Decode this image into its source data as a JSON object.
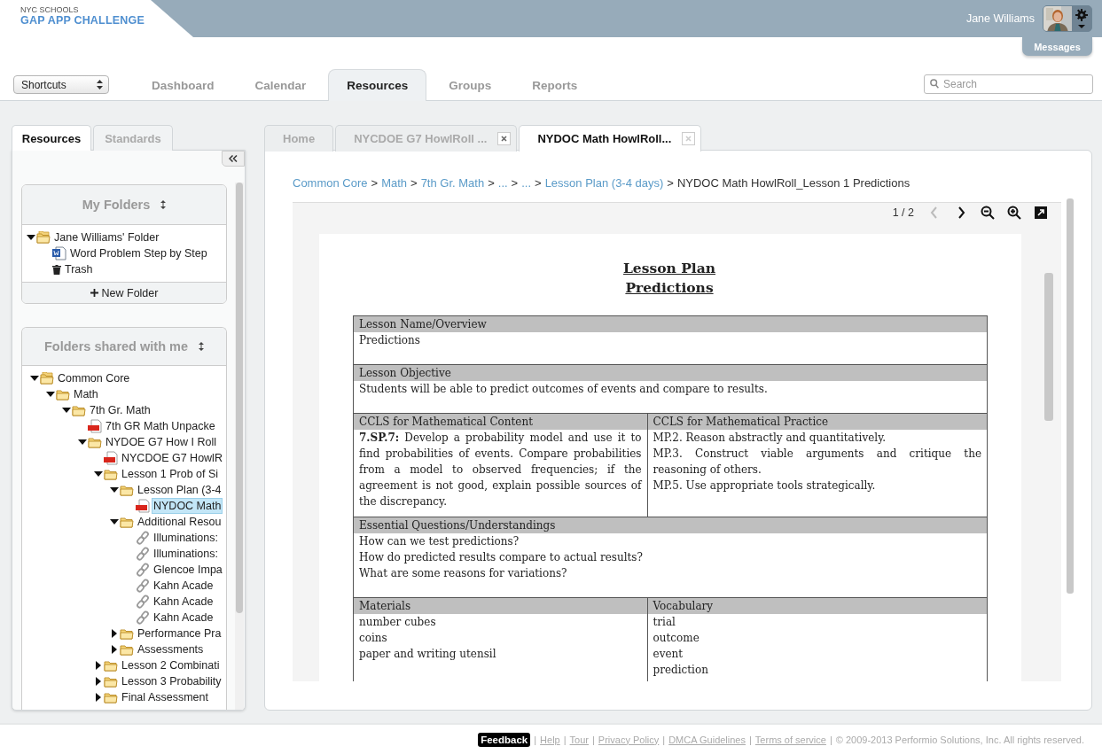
{
  "header": {
    "logo_small": "NYC SCHOOLS",
    "logo_main": "GAP APP CHALLENGE",
    "user_name": "Jane Williams",
    "messages": "Messages"
  },
  "nav": {
    "shortcuts": "Shortcuts",
    "tabs": [
      {
        "label": "Dashboard",
        "selected": false
      },
      {
        "label": "Calendar",
        "selected": false
      },
      {
        "label": "Resources",
        "selected": true
      },
      {
        "label": "Groups",
        "selected": false
      },
      {
        "label": "Reports",
        "selected": false
      }
    ],
    "search": {
      "placeholder": "Search"
    }
  },
  "sidebar": {
    "tabs": [
      {
        "label": "Resources",
        "selected": true
      },
      {
        "label": "Standards",
        "selected": false
      }
    ],
    "my_folders": {
      "title": "My Folders",
      "tree": [
        {
          "kind": "shared",
          "label": "Jane Williams' Folder",
          "expanded": true,
          "selected": false,
          "children": [
            {
              "kind": "word",
              "label": "Word Problem Step by Step",
              "selected": false
            },
            {
              "kind": "trash",
              "label": "Trash",
              "selected": false
            }
          ]
        }
      ],
      "new_folder": "New Folder"
    },
    "shared_folders": {
      "title": "Folders shared with me",
      "tree": [
        {
          "kind": "shared",
          "label": "Common Core",
          "expanded": true,
          "selected": false,
          "children": [
            {
              "kind": "folder",
              "label": "Math",
              "expanded": true,
              "selected": false,
              "children": [
                {
                  "kind": "folder",
                  "label": "7th Gr. Math",
                  "expanded": true,
                  "selected": false,
                  "children": [
                    {
                      "kind": "pdf",
                      "label": "7th GR Math Unpacke",
                      "selected": false
                    },
                    {
                      "kind": "folder",
                      "label": "NYDOE G7 How I Roll",
                      "expanded": true,
                      "selected": false,
                      "children": [
                        {
                          "kind": "pdf",
                          "label": "NYCDOE G7 HowlR",
                          "selected": false
                        },
                        {
                          "kind": "folder",
                          "label": "Lesson 1 Prob of Si",
                          "expanded": true,
                          "selected": false,
                          "children": [
                            {
                              "kind": "folder",
                              "label": "Lesson Plan (3-4",
                              "expanded": true,
                              "selected": false,
                              "children": [
                                {
                                  "kind": "pdf",
                                  "label": "NYDOC Math",
                                  "selected": true
                                }
                              ]
                            },
                            {
                              "kind": "folder",
                              "label": "Additional Resou",
                              "expanded": true,
                              "selected": false,
                              "children": [
                                {
                                  "kind": "link",
                                  "label": "Illuminations:",
                                  "selected": false
                                },
                                {
                                  "kind": "link",
                                  "label": "Illuminations:",
                                  "selected": false
                                },
                                {
                                  "kind": "link",
                                  "label": "Glencoe Impa",
                                  "selected": false
                                },
                                {
                                  "kind": "link",
                                  "label": "Kahn Acade",
                                  "selected": false
                                },
                                {
                                  "kind": "link",
                                  "label": "Kahn Acade",
                                  "selected": false
                                },
                                {
                                  "kind": "link",
                                  "label": "Kahn Acade",
                                  "selected": false
                                }
                              ]
                            },
                            {
                              "kind": "folder",
                              "label": "Performance Pra",
                              "expanded": false,
                              "selected": false
                            },
                            {
                              "kind": "folder",
                              "label": "Assessments",
                              "expanded": false,
                              "selected": false
                            }
                          ]
                        },
                        {
                          "kind": "folder",
                          "label": "Lesson 2 Combinati",
                          "expanded": false,
                          "selected": false
                        },
                        {
                          "kind": "folder",
                          "label": "Lesson 3 Probability",
                          "expanded": false,
                          "selected": false
                        },
                        {
                          "kind": "folder",
                          "label": "Final Assessment",
                          "expanded": false,
                          "selected": false
                        }
                      ]
                    }
                  ]
                }
              ]
            }
          ]
        }
      ]
    }
  },
  "content": {
    "tabs": [
      {
        "label": "Home",
        "selected": false,
        "closable": false
      },
      {
        "label": "NYCDOE G7 HowlRoll ...",
        "selected": false,
        "closable": true
      },
      {
        "label": "NYDOC Math HowlRoll...",
        "selected": true,
        "closable": true
      }
    ],
    "breadcrumb": [
      {
        "kind": "link",
        "label": "Common Core"
      },
      {
        "kind": "link",
        "label": "Math"
      },
      {
        "kind": "link",
        "label": "7th Gr. Math"
      },
      {
        "kind": "link",
        "label": "..."
      },
      {
        "kind": "link",
        "label": "..."
      },
      {
        "kind": "link",
        "label": "Lesson Plan (3-4 days)"
      },
      {
        "kind": "current",
        "label": "NYDOC Math HowlRoll_Lesson 1 Predictions"
      }
    ],
    "breadcrumb_separator": ">",
    "viewer": {
      "page": "1 / 2",
      "tools": [
        {
          "kind": "prev",
          "disabled": true
        },
        {
          "kind": "next",
          "disabled": false
        },
        {
          "kind": "zoom_out",
          "disabled": false
        },
        {
          "kind": "zoom_in",
          "disabled": false
        },
        {
          "kind": "popout",
          "disabled": false
        }
      ]
    },
    "document": {
      "title_lines": [
        "Lesson Plan",
        "Predictions"
      ],
      "sections": [
        {
          "kind": "single",
          "heading": "Lesson Name/Overview",
          "lines": [
            "Predictions"
          ]
        },
        {
          "kind": "single",
          "heading": "Lesson Objective",
          "lines": [
            "Students will be able to predict outcomes of events and compare to results."
          ]
        },
        {
          "kind": "double",
          "columns": [
            {
              "heading": "CCLS for Mathematical Content",
              "lines": [
                "**7.SP.7:** Develop a probability model and use it to find probabilities of events. Compare probabilities from a model to observed frequencies; if the agreement is not good, explain possible sources of the discrepancy."
              ]
            },
            {
              "heading": "CCLS for Mathematical Practice",
              "lines": [
                "MP.2. Reason abstractly and quantitatively.",
                "MP.3. Construct viable arguments and critique the reasoning of others.",
                "MP.5. Use appropriate tools strategically."
              ]
            }
          ]
        },
        {
          "kind": "single",
          "heading": "Essential Questions/Understandings",
          "lines": [
            "How can we test predictions?",
            "How do predicted results compare to actual results?",
            "What are some reasons for variations?"
          ]
        },
        {
          "kind": "double",
          "columns": [
            {
              "heading": "Materials",
              "lines": [
                "number cubes",
                "coins",
                "paper and writing utensil"
              ]
            },
            {
              "heading": "Vocabulary",
              "lines": [
                "trial",
                "outcome",
                "event",
                "prediction"
              ]
            }
          ]
        }
      ]
    }
  },
  "footer": {
    "feedback": "Feedback",
    "separator": "|",
    "links": [
      "Help",
      "Tour",
      "Privacy Policy",
      "DMCA Guidelines",
      "Terms of service"
    ],
    "copyright": "© 2009-2013 Performio Solutions, Inc. All rights reserved."
  }
}
